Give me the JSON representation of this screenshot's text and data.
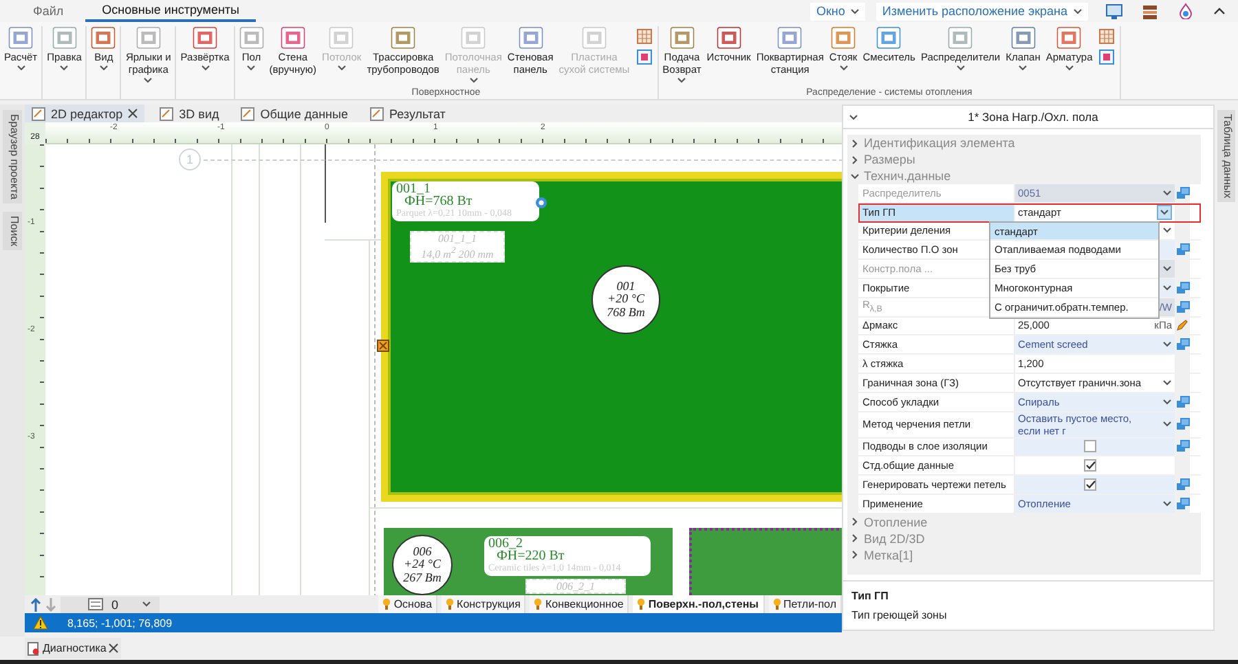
{
  "menu_tabs": [
    {
      "label": "Файл",
      "selected": false
    },
    {
      "label": "Основные инструменты",
      "selected": true
    }
  ],
  "window_menus": [
    {
      "label": "Окно"
    },
    {
      "label": "Изменить расположение экрана"
    }
  ],
  "ribbon": {
    "groups": [
      {
        "buttons": [
          {
            "label": "Расчёт",
            "dropdown": true,
            "disabled": false
          }
        ]
      },
      {
        "buttons": [
          {
            "label": "Правка",
            "dropdown": true,
            "disabled": false
          }
        ]
      },
      {
        "buttons": [
          {
            "label": "Вид",
            "dropdown": true,
            "disabled": false
          }
        ]
      },
      {
        "buttons": [
          {
            "label": "Ярлыки и\nграфика",
            "dropdown": true,
            "disabled": false
          }
        ]
      },
      {
        "buttons": [
          {
            "label": "Развёртка",
            "dropdown": true,
            "disabled": false
          }
        ]
      },
      {
        "label": "Поверхностное",
        "small_tools": true,
        "buttons": [
          {
            "label": "Пол",
            "dropdown": true,
            "disabled": false
          },
          {
            "label": "Стена\n(вручную)",
            "dropdown": false,
            "disabled": false
          },
          {
            "label": "Потолок",
            "dropdown": true,
            "disabled": true
          },
          {
            "label": "Трассировка\nтрубопроводов",
            "dropdown": false,
            "disabled": false
          },
          {
            "label": "Потолочная\nпанель",
            "dropdown": true,
            "disabled": true
          },
          {
            "label": "Стеновая\nпанель",
            "dropdown": false,
            "disabled": false
          },
          {
            "label": "Пластина\nсухой системы",
            "dropdown": false,
            "disabled": true
          }
        ]
      },
      {
        "label": "Распределение - системы отопления",
        "small_tools": true,
        "buttons": [
          {
            "label": "Подача\nВозврат",
            "dropdown": true,
            "disabled": false
          },
          {
            "label": "Источник",
            "dropdown": false,
            "disabled": false
          },
          {
            "label": "Поквартирная\nстанция",
            "dropdown": false,
            "disabled": false
          },
          {
            "label": "Стояк",
            "dropdown": true,
            "disabled": false
          },
          {
            "label": "Смеситель",
            "dropdown": false,
            "disabled": false
          },
          {
            "label": "Распределители",
            "dropdown": true,
            "disabled": false
          },
          {
            "label": "Клапан",
            "dropdown": true,
            "disabled": false
          },
          {
            "label": "Арматура",
            "dropdown": true,
            "disabled": false
          }
        ]
      }
    ]
  },
  "left_panels": [
    {
      "label": "Браузер проекта"
    },
    {
      "label": "Поиск"
    }
  ],
  "right_panels": [
    {
      "label": "Таблица данных"
    }
  ],
  "doc_tabs": [
    {
      "label": "2D редактор",
      "selected": true,
      "closable": true
    },
    {
      "label": "3D вид",
      "selected": false,
      "closable": false
    },
    {
      "label": "Общие данные",
      "selected": false,
      "closable": false
    },
    {
      "label": "Результат",
      "selected": false,
      "closable": false
    }
  ],
  "canvas": {
    "ruler": {
      "corner": "28",
      "x_labels": [
        "-2",
        "-1",
        "0",
        "1",
        "2"
      ],
      "y_labels": [
        "-1",
        "-2",
        "-3"
      ]
    },
    "grid_marker": "1",
    "zone_labels": [
      {
        "title": "001_1",
        "power": "ФН=768 Вт",
        "layer": "Parquet λ=0,21 10mm - 0,048"
      },
      {
        "title": "006_2",
        "power": "ФН=220 Вт",
        "layer": "Ceramic tiles λ=1,0 14mm - 0,014"
      }
    ],
    "circuit_labels": [
      {
        "lines": [
          "001_1_1",
          "14,0 m$^{2}$   200 mm"
        ]
      },
      {
        "lines": [
          "006_2_1"
        ]
      }
    ],
    "room_tags": [
      {
        "lines": [
          "001",
          "+20 °C",
          "768 Вт"
        ]
      },
      {
        "lines": [
          "006",
          "+24 °C",
          "267 Вт"
        ]
      }
    ]
  },
  "layer_tabs": [
    {
      "label": "Основа",
      "selected": false
    },
    {
      "label": "Конструкция",
      "selected": false
    },
    {
      "label": "Конвекционное",
      "selected": false
    },
    {
      "label": "Поверхн.-пол,стены",
      "selected": true
    },
    {
      "label": "Петли-пол",
      "selected": false
    }
  ],
  "level_select": {
    "value": "0"
  },
  "status_bar": {
    "coordinates": "8,165; -1,001; 76,809"
  },
  "bottom_tabs": [
    {
      "label": "Диагностика"
    }
  ],
  "properties": {
    "title": "1* Зона Нагр./Охл. пола",
    "sections": [
      {
        "label": "Идентификация элемента",
        "expanded": false
      },
      {
        "label": "Размеры",
        "expanded": false
      },
      {
        "label": "Технич.данные",
        "expanded": true,
        "rows": [
          {
            "label": "Распределитель",
            "value": "0051",
            "kind": "dropdown",
            "disabled": true,
            "linked": true,
            "selected": false
          },
          {
            "label": "Тип ГП",
            "value": "стандарт",
            "kind": "dropdown",
            "disabled": false,
            "linked": false,
            "selected": true
          },
          {
            "label": "Критерии деления",
            "kind": "dropdown",
            "disabled": false,
            "linked": false,
            "selected": false
          },
          {
            "label": "Количество П.О зон",
            "kind": "text",
            "disabled": false,
            "linked": true,
            "selected": false
          },
          {
            "label": "Констр.пола ...",
            "kind": "dropdown",
            "disabled": true,
            "linked": false,
            "selected": false
          },
          {
            "label": "Покрытие",
            "kind": "dropdown",
            "disabled": false,
            "linked": true,
            "selected": false
          },
          {
            "label": "R$_{λ,B}$",
            "value": "/W",
            "right_aligned": true,
            "kind": "text",
            "disabled": true,
            "linked": true,
            "selected": false
          },
          {
            "label": "Δрмакс",
            "value": "25,000",
            "unit": "кПа",
            "kind": "unit",
            "disabled": false,
            "linked": false,
            "selected": false
          },
          {
            "label": "Стяжка",
            "value": "Cement screed",
            "kind": "dropdown",
            "disabled": false,
            "linked": true,
            "selected": false
          },
          {
            "label": "λ стяжка",
            "value": "1,200",
            "kind": "text",
            "disabled": false,
            "linked": false,
            "selected": false
          },
          {
            "label": "Граничная зона (ГЗ)",
            "value": "Отсутствует граничн.зона",
            "kind": "dropdown",
            "disabled": false,
            "linked": false,
            "selected": false
          },
          {
            "label": "Способ укладки",
            "value": "Спираль",
            "kind": "dropdown",
            "disabled": false,
            "linked": true,
            "selected": false
          },
          {
            "label": "Метод черчения петли",
            "value": "Оставить пустое место, если нет г",
            "kind": "dropdown",
            "disabled": false,
            "linked": true,
            "selected": false
          },
          {
            "label": "Подводы в слое изоляции",
            "kind": "checkbox",
            "checked": false,
            "disabled": false,
            "linked": true,
            "selected": false
          },
          {
            "label": "Стд.общие данные",
            "kind": "checkbox",
            "checked": true,
            "disabled": false,
            "linked": false,
            "selected": false
          },
          {
            "label": "Генерировать чертежи петель",
            "kind": "checkbox",
            "checked": true,
            "disabled": false,
            "linked": true,
            "selected": false
          },
          {
            "label": "Применение",
            "value": "Отопление",
            "kind": "dropdown",
            "disabled": false,
            "linked": true,
            "selected": false
          }
        ]
      },
      {
        "label": "Отопление",
        "expanded": false
      },
      {
        "label": "Вид 2D/3D",
        "expanded": false
      },
      {
        "label": "Метка[1]",
        "expanded": false
      }
    ],
    "dropdown_options": [
      {
        "label": "стандарт",
        "selected": true
      },
      {
        "label": "Отапливаемая подводами",
        "selected": false
      },
      {
        "label": "Без труб",
        "selected": false
      },
      {
        "label": "Многоконтурная",
        "selected": false
      },
      {
        "label": "С ограничит.обратн.темпер.",
        "selected": false
      }
    ],
    "description": {
      "title": "Тип ГП",
      "text": "Тип греющей зоны"
    }
  }
}
